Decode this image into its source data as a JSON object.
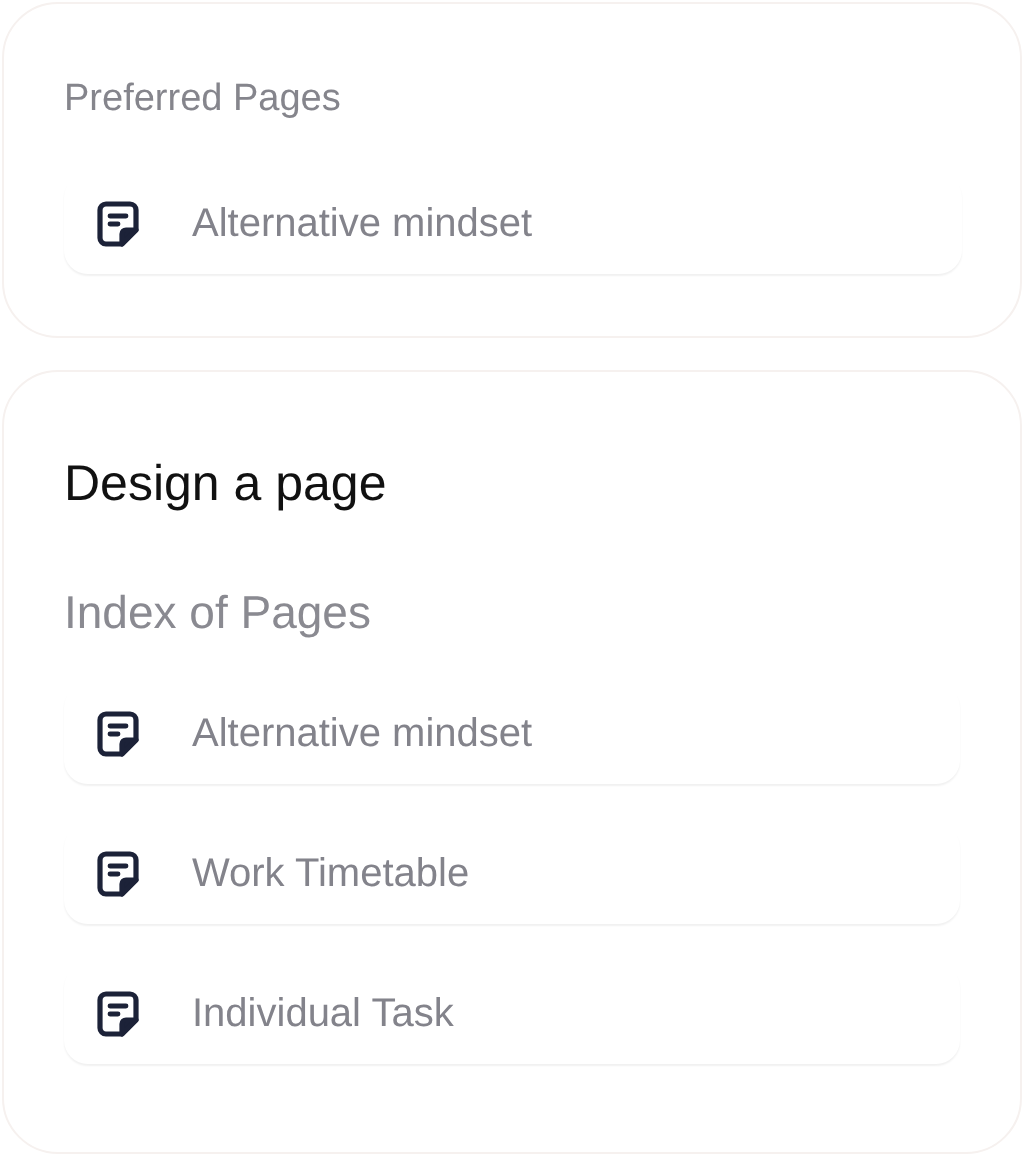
{
  "preferred": {
    "title": "Preferred Pages",
    "items": [
      {
        "label": "Alternative mindset"
      }
    ]
  },
  "design": {
    "heading": "Design a page",
    "subtitle": "Index of Pages",
    "items": [
      {
        "label": "Alternative mindset"
      },
      {
        "label": "Work Timetable"
      },
      {
        "label": "Individual Task"
      }
    ]
  }
}
